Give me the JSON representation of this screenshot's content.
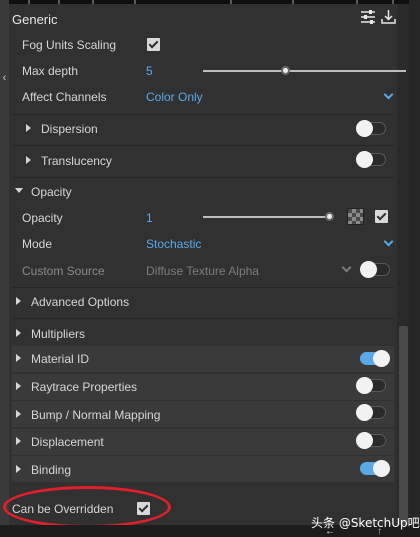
{
  "header": {
    "title": "Generic"
  },
  "fog_units_scaling": {
    "label": "Fog Units Scaling",
    "checked": true
  },
  "max_depth": {
    "label": "Max depth",
    "value": "5",
    "slider_fraction": 0.41
  },
  "affect_channels": {
    "label": "Affect Channels",
    "value": "Color Only"
  },
  "dispersion": {
    "label": "Dispersion",
    "enabled": false
  },
  "translucency": {
    "label": "Translucency",
    "enabled": false
  },
  "opacity_section": {
    "label": "Opacity",
    "expanded": true
  },
  "opacity": {
    "label": "Opacity",
    "value": "1",
    "slider_fraction": 1.0,
    "checked": true
  },
  "mode": {
    "label": "Mode",
    "value": "Stochastic"
  },
  "custom_source": {
    "label": "Custom Source",
    "value": "Diffuse Texture Alpha",
    "enabled": false
  },
  "sections": [
    {
      "label": "Advanced Options",
      "toggle": null
    },
    {
      "label": "Multipliers",
      "toggle": null
    },
    {
      "label": "Material ID",
      "toggle": true
    },
    {
      "label": "Raytrace Properties",
      "toggle": false
    },
    {
      "label": "Bump / Normal Mapping",
      "toggle": false
    },
    {
      "label": "Displacement",
      "toggle": false
    },
    {
      "label": "Binding",
      "toggle": true
    }
  ],
  "overridden": {
    "label": "Can be Overridden",
    "checked": true
  },
  "watermark": "头条 @SketchUp吧",
  "colors": {
    "accent": "#5aa9e6",
    "highlight": "#e0202a"
  },
  "icons": [
    "sliders-icon",
    "import-icon",
    "chevron-left-icon"
  ]
}
